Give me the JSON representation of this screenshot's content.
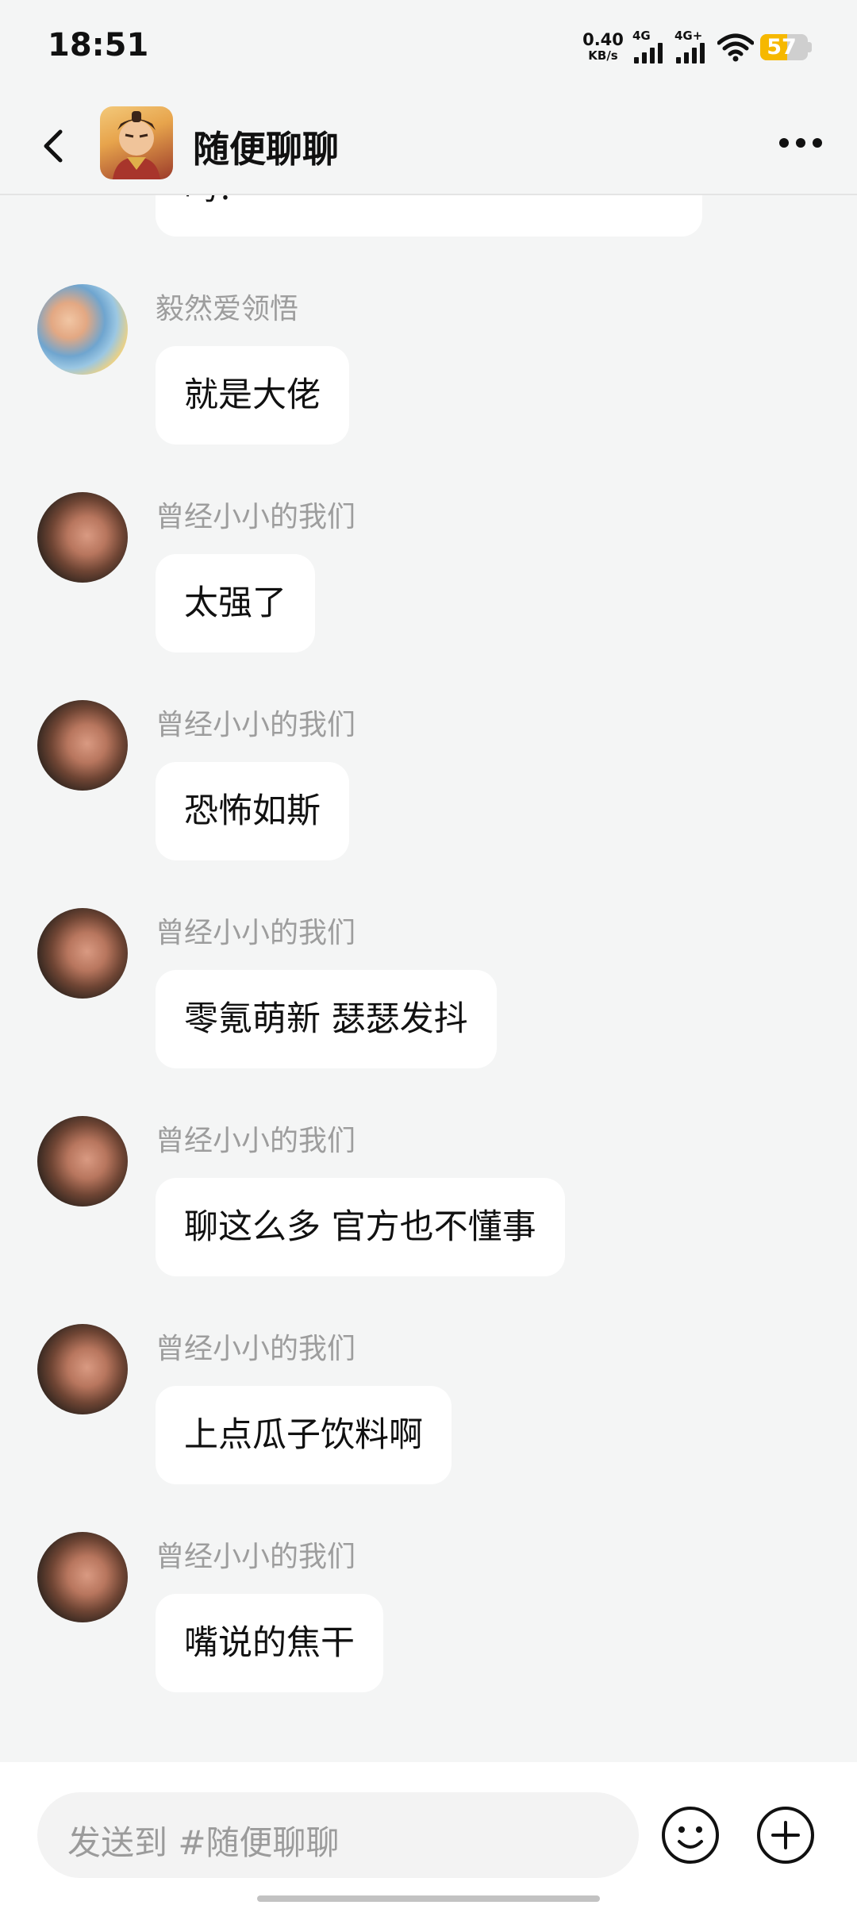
{
  "status_bar": {
    "time": "18:51",
    "net_speed_value": "0.40",
    "net_speed_unit": "KB/s",
    "signal1_label": "4G",
    "signal2_label": "4G+",
    "battery": "57",
    "battery_level": 0.57,
    "battery_color": "#f6b800"
  },
  "header": {
    "back_icon": "chevron-left-icon",
    "title": "随便聊聊",
    "more_icon": "more-dots-icon"
  },
  "partial_message": {
    "text": "吗？"
  },
  "messages": [
    {
      "sender": "毅然爱领悟",
      "text": "就是大佬"
    },
    {
      "sender": "曾经小小的我们",
      "text": "太强了"
    },
    {
      "sender": "曾经小小的我们",
      "text": "恐怖如斯"
    },
    {
      "sender": "曾经小小的我们",
      "text": "零氪萌新 瑟瑟发抖"
    },
    {
      "sender": "曾经小小的我们",
      "text": "聊这么多 官方也不懂事"
    },
    {
      "sender": "曾经小小的我们",
      "text": "上点瓜子饮料啊"
    },
    {
      "sender": "曾经小小的我们",
      "text": "嘴说的焦干"
    }
  ],
  "input": {
    "placeholder": "发送到 #随便聊聊",
    "emoji_icon": "emoji-smile-icon",
    "plus_icon": "plus-circle-icon"
  }
}
